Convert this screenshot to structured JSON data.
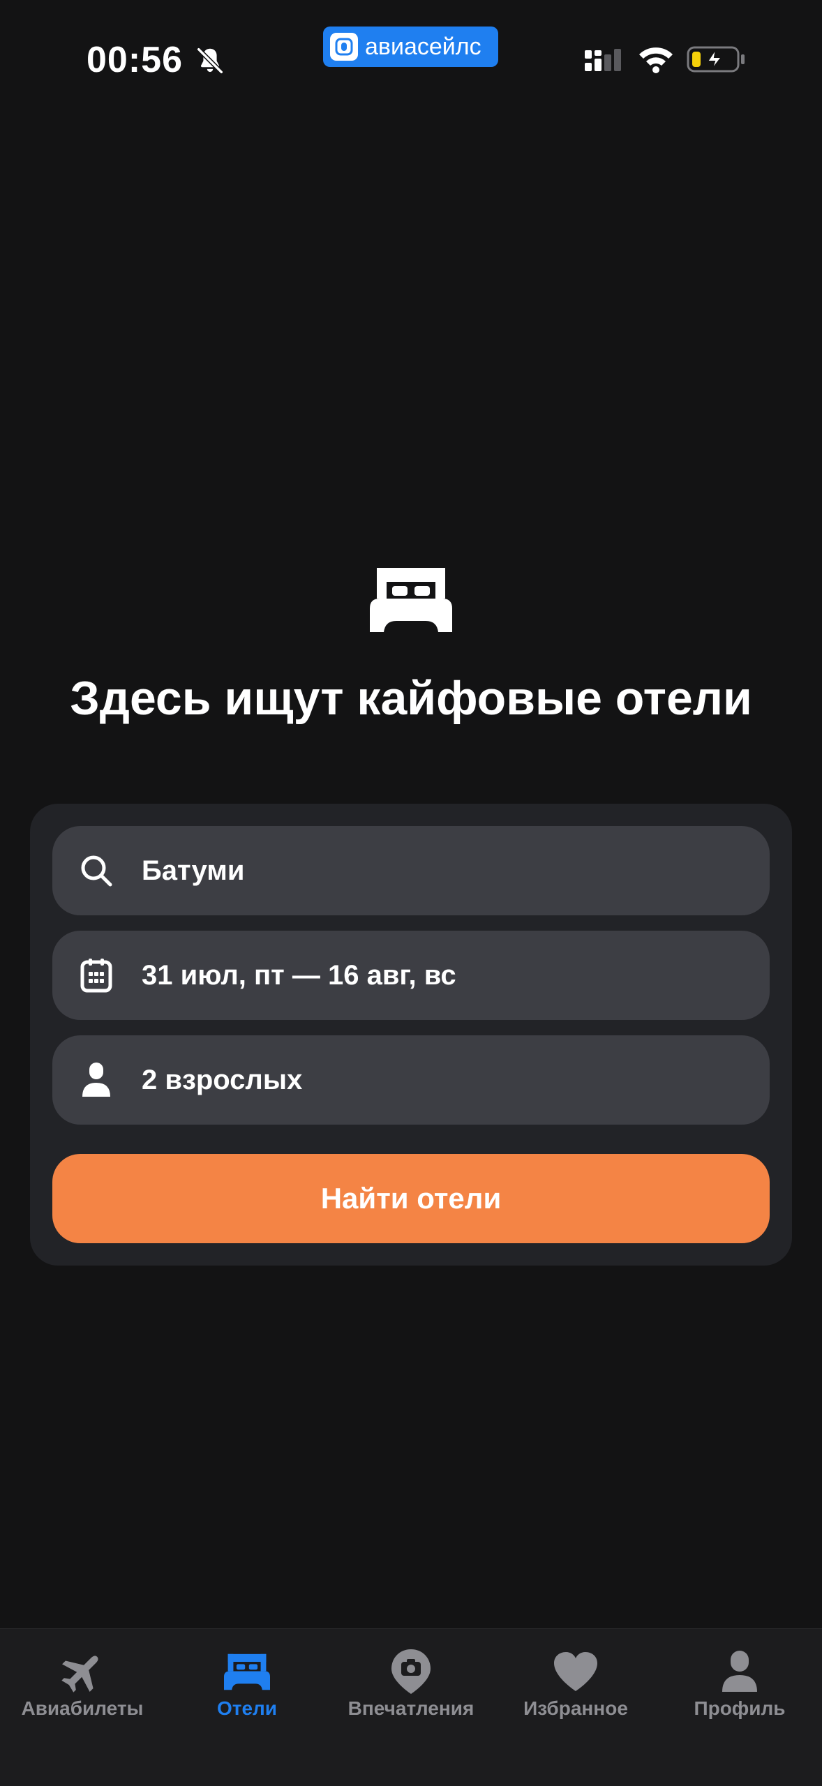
{
  "status_bar": {
    "time": "00:56",
    "app_badge": "авиасейлс",
    "icons": [
      "bell-off-icon",
      "signal-icon",
      "wifi-icon",
      "battery-charging-icon"
    ]
  },
  "hero": {
    "icon": "bed-icon",
    "title": "Здесь ищут кайфовые отели"
  },
  "search": {
    "destination": "Батуми",
    "dates": "31 июл, пт — 16 авг, вс",
    "guests": "2 взрослых",
    "submit_label": "Найти отели"
  },
  "tabs": [
    {
      "label": "Авиабилеты",
      "icon": "airplane-icon",
      "active": false
    },
    {
      "label": "Отели",
      "icon": "bed-icon",
      "active": true
    },
    {
      "label": "Впечатления",
      "icon": "location-pin-icon",
      "active": false
    },
    {
      "label": "Избранное",
      "icon": "heart-icon",
      "active": false
    },
    {
      "label": "Профиль",
      "icon": "person-icon",
      "active": false
    }
  ],
  "colors": {
    "background": "#131314",
    "card": "#222327",
    "field": "#3d3e44",
    "accent_orange": "#f48445",
    "accent_blue": "#1f7ff0",
    "tab_inactive": "#8e8e93"
  }
}
